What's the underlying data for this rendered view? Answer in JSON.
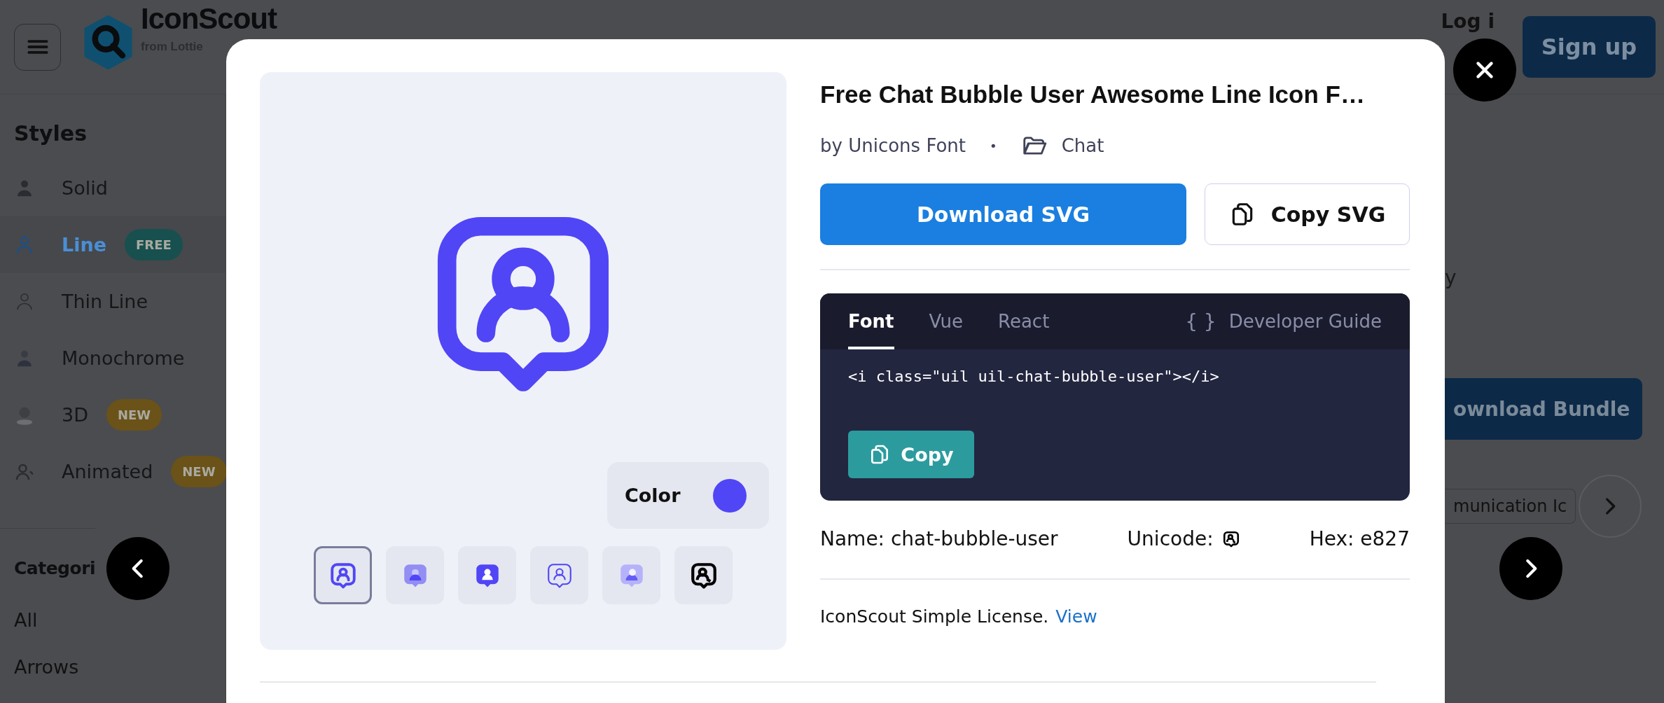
{
  "background_page": {
    "header": {
      "logo_text": "IconScout",
      "logo_subtext": "from Lottie",
      "login": "Log i",
      "signup": "Sign up"
    },
    "sidebar": {
      "styles_heading": "Styles",
      "styles": [
        {
          "label": "Solid",
          "kind": "solid",
          "selected": false
        },
        {
          "label": "Line",
          "kind": "line",
          "selected": true,
          "badge": {
            "text": "FREE",
            "color": "#17504f"
          }
        },
        {
          "label": "Thin Line",
          "kind": "thin",
          "selected": false
        },
        {
          "label": "Monochrome",
          "kind": "mono",
          "selected": false
        },
        {
          "label": "3D",
          "kind": "rendered",
          "selected": false,
          "badge": {
            "text": "NEW",
            "color": "#6a5218"
          }
        },
        {
          "label": "Animated",
          "kind": "animated",
          "selected": false,
          "badge": {
            "text": "NEW",
            "color": "#6a5218"
          }
        }
      ],
      "categories_heading": "Categori",
      "categories": [
        "All",
        "Arrows"
      ]
    },
    "main": {
      "text_fragment": "y",
      "bundle_button": "ownload Bundle",
      "tag_chip": "munication Ic"
    }
  },
  "modal": {
    "title": "Free Chat Bubble User Awesome Line Icon F…",
    "author": "by Unicons Font",
    "separator": "•",
    "category": "Chat",
    "color_picker": {
      "label": "Color",
      "color": "#5046f5"
    },
    "variants": [
      {
        "kind": "line",
        "selected": true
      },
      {
        "kind": "duotone",
        "selected": false
      },
      {
        "kind": "solid",
        "selected": false
      },
      {
        "kind": "thin",
        "selected": false
      },
      {
        "kind": "rendered",
        "selected": false
      },
      {
        "kind": "mono",
        "selected": false
      }
    ],
    "download_button": "Download SVG",
    "copy_svg_button": "Copy SVG",
    "code_tabs": [
      {
        "label": "Font",
        "selected": true
      },
      {
        "label": "Vue",
        "selected": false
      },
      {
        "label": "React",
        "selected": false
      }
    ],
    "developer_guide": {
      "icon": "{ }",
      "label": "Developer Guide"
    },
    "code": "<i class=\"uil uil-chat-bubble-user\"></i>",
    "copy_button": "Copy",
    "name": "Name: chat-bubble-user",
    "unicode_label": "Unicode:",
    "hex": "Hex: e827",
    "license": "IconScout Simple License.",
    "license_link": "View"
  }
}
